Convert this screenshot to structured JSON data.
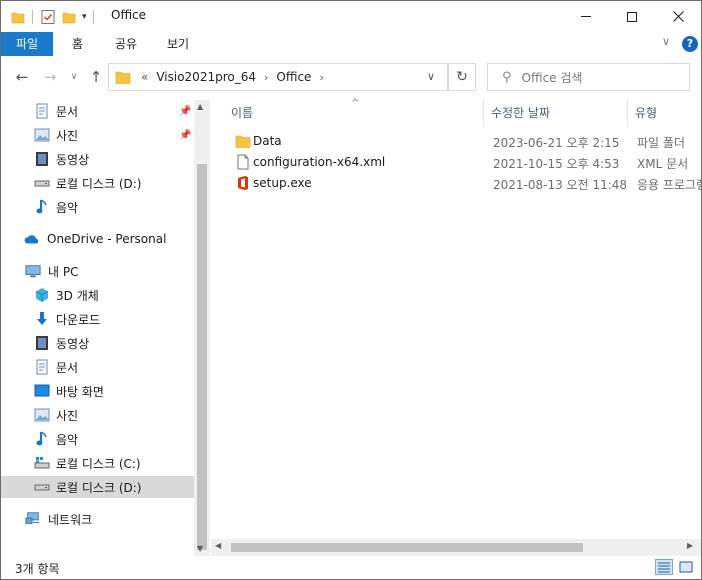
{
  "window": {
    "title": "Office",
    "ribbon_tabs": [
      {
        "label": "파일",
        "active": true
      },
      {
        "label": "홈",
        "active": false
      },
      {
        "label": "공유",
        "active": false
      },
      {
        "label": "보기",
        "active": false
      }
    ],
    "help_label": "?"
  },
  "address": {
    "overflow": "«",
    "breadcrumbs": [
      "Visio2021pro_64",
      "Office"
    ],
    "search_placeholder": "Office 검색"
  },
  "nav_pane": {
    "items": [
      {
        "label": "문서",
        "icon": "documents-icon",
        "pinned": true
      },
      {
        "label": "사진",
        "icon": "pictures-icon",
        "pinned": true
      },
      {
        "label": "동영상",
        "icon": "videos-icon",
        "pinned": false
      },
      {
        "label": "로컬 디스크 (D:)",
        "icon": "drive-icon",
        "pinned": false
      },
      {
        "label": "음악",
        "icon": "music-icon",
        "pinned": false
      },
      {
        "label": "OneDrive - Personal",
        "icon": "onedrive-icon",
        "pinned": false
      },
      {
        "label": "내 PC",
        "icon": "this-pc-icon",
        "pinned": false
      },
      {
        "label": "3D 개체",
        "icon": "3d-objects-icon",
        "pinned": false
      },
      {
        "label": "다운로드",
        "icon": "downloads-icon",
        "pinned": false
      },
      {
        "label": "동영상",
        "icon": "videos-icon",
        "pinned": false
      },
      {
        "label": "문서",
        "icon": "documents-icon",
        "pinned": false
      },
      {
        "label": "바탕 화면",
        "icon": "desktop-icon",
        "pinned": false
      },
      {
        "label": "사진",
        "icon": "pictures-icon",
        "pinned": false
      },
      {
        "label": "음악",
        "icon": "music-icon",
        "pinned": false
      },
      {
        "label": "로컬 디스크 (C:)",
        "icon": "system-drive-icon",
        "pinned": false
      },
      {
        "label": "로컬 디스크 (D:)",
        "icon": "drive-icon",
        "pinned": false,
        "selected": true
      },
      {
        "label": "네트워크",
        "icon": "network-icon",
        "pinned": false
      }
    ]
  },
  "columns": {
    "name": "이름",
    "modified": "수정한 날짜",
    "type": "유형"
  },
  "files": [
    {
      "name": "Data",
      "date": "2023-06-21 오후 2:15",
      "type": "파일 폴더",
      "icon": "folder-icon"
    },
    {
      "name": "configuration-x64.xml",
      "date": "2021-10-15 오후 4:53",
      "type": "XML 문서",
      "icon": "xml-file-icon"
    },
    {
      "name": "setup.exe",
      "date": "2021-08-13 오전 11:48",
      "type": "응용 프로그램",
      "icon": "office-setup-icon"
    }
  ],
  "status": {
    "item_count": "3개 항목"
  },
  "colors": {
    "accent": "#1979ca",
    "folder": "#f5c542",
    "office": "#d83b01"
  }
}
